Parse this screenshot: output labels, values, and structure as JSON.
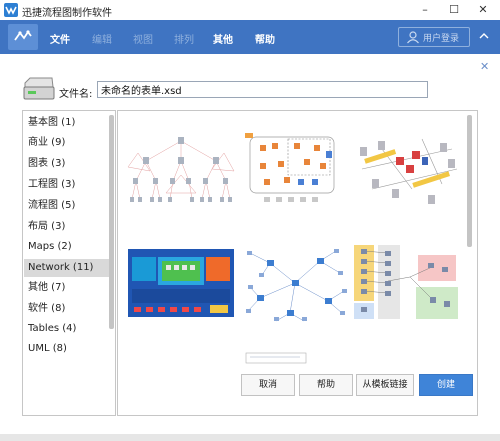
{
  "window": {
    "title": "迅捷流程图制作软件",
    "minimize_glyph": "–",
    "maximize_glyph": "☐",
    "close_glyph": "✕"
  },
  "toolbar": {
    "menu": [
      {
        "label": "文件",
        "enabled": true
      },
      {
        "label": "编辑",
        "enabled": false
      },
      {
        "label": "视图",
        "enabled": false
      },
      {
        "label": "排列",
        "enabled": false
      },
      {
        "label": "其他",
        "enabled": true
      },
      {
        "label": "帮助",
        "enabled": true
      }
    ],
    "login_label": "用户登录",
    "accent_color": "#3f74c2"
  },
  "dialog": {
    "close_glyph": "✕",
    "file_label": "文件名:",
    "file_name": "未命名的表单.xsd",
    "categories": [
      {
        "label": "基本图 (1)",
        "selected": false
      },
      {
        "label": "商业 (9)",
        "selected": false
      },
      {
        "label": "图表 (3)",
        "selected": false
      },
      {
        "label": "工程图 (3)",
        "selected": false
      },
      {
        "label": "流程图 (5)",
        "selected": false
      },
      {
        "label": "布局 (3)",
        "selected": false
      },
      {
        "label": "Maps (2)",
        "selected": false
      },
      {
        "label": "Network (11)",
        "selected": true
      },
      {
        "label": "其他 (7)",
        "selected": false
      },
      {
        "label": "软件 (8)",
        "selected": false
      },
      {
        "label": "Tables (4)",
        "selected": false
      },
      {
        "label": "UML (8)",
        "selected": false
      }
    ],
    "buttons": {
      "cancel": "取消",
      "help": "帮助",
      "from_template_link": "从模板链接",
      "create": "创建"
    }
  }
}
